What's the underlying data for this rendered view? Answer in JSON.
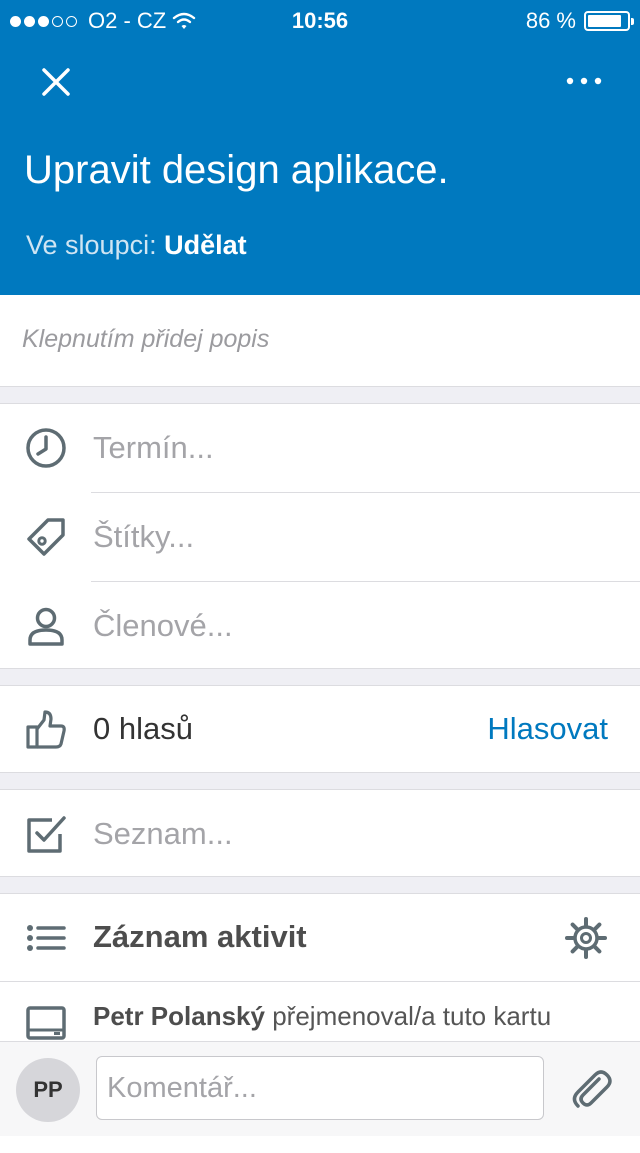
{
  "status_bar": {
    "carrier": "O2 - CZ",
    "signal_bars_filled": 3,
    "signal_bars_total": 5,
    "time": "10:56",
    "battery": "86 %",
    "battery_level": 0.86
  },
  "header": {
    "card_title": "Upravit design aplikace.",
    "column_prefix": "Ve sloupci:",
    "column_name": "Udělat",
    "close_icon": "close-icon",
    "more_icon": "more-dots-icon"
  },
  "description": {
    "placeholder": "Klepnutím přidej popis"
  },
  "fields": [
    {
      "label": "Termín...",
      "icon": "clock-icon"
    },
    {
      "label": "Štítky...",
      "icon": "tag-icon"
    },
    {
      "label": "Členové...",
      "icon": "person-icon"
    }
  ],
  "votes": {
    "count_label": "0 hlasů",
    "action_label": "Hlasovat",
    "icon": "thumbs-up-icon"
  },
  "checklist": {
    "label": "Seznam...",
    "icon": "checkbox-icon"
  },
  "activity": {
    "title": "Záznam aktivit",
    "icon": "list-icon",
    "settings_icon": "gear-icon",
    "entries": [
      {
        "user": "Petr Polanský",
        "text": "přejmenoval/a tuto kartu",
        "icon": "laptop-icon"
      }
    ]
  },
  "comment": {
    "avatar_initials": "PP",
    "placeholder": "Komentář...",
    "attach_icon": "paperclip-icon"
  },
  "colors": {
    "header_bg": "#0079bf",
    "accent": "#0079bf",
    "background": "#efeff4"
  }
}
